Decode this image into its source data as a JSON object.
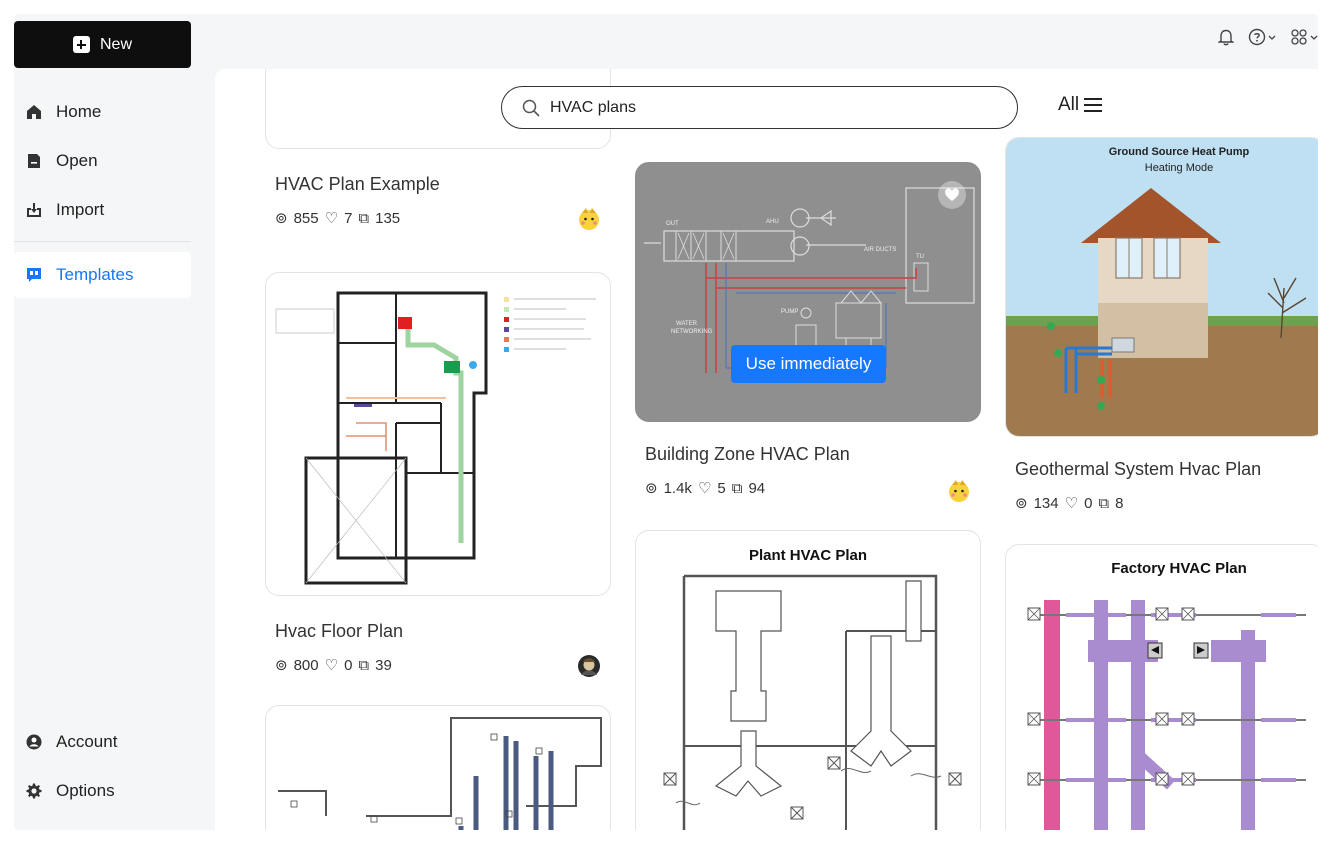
{
  "sidebar": {
    "new_label": "New",
    "items": [
      {
        "label": "Home"
      },
      {
        "label": "Open"
      },
      {
        "label": "Import"
      },
      {
        "label": "Templates"
      },
      {
        "label": "Account"
      },
      {
        "label": "Options"
      }
    ]
  },
  "search": {
    "value": "HVAC plans"
  },
  "filter": {
    "label": "All"
  },
  "cards": [
    {
      "title": "HVAC Plan Example",
      "views": "855",
      "likes": "7",
      "copies": "135"
    },
    {
      "title": "Hvac Floor Plan",
      "views": "800",
      "likes": "0",
      "copies": "39"
    },
    {
      "title": "Building Zone HVAC Plan",
      "views": "1.4k",
      "likes": "5",
      "copies": "94",
      "action_label": "Use immediately"
    },
    {
      "title": "Plant HVAC Plan",
      "thumb_title": "Plant HVAC Plan"
    },
    {
      "title": "Geothermal System Hvac Plan",
      "views": "134",
      "likes": "0",
      "copies": "8",
      "thumb_title": "Ground Source Heat Pump",
      "thumb_subtitle": "Heating Mode"
    },
    {
      "title": "Factory HVAC Plan",
      "thumb_title": "Factory HVAC Plan"
    }
  ],
  "colors": {
    "accent": "#1677ff",
    "new_button": "#0e0e0e",
    "sidebar_bg": "#f5f6f8",
    "duct_purple": "#a98bd0",
    "duct_pink": "#e0579a"
  }
}
